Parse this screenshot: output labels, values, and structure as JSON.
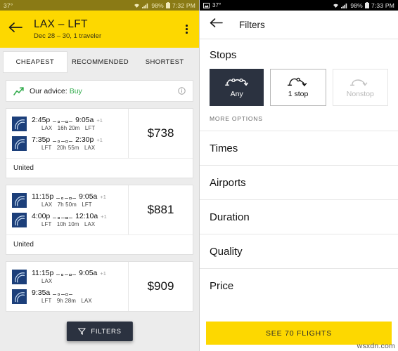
{
  "left": {
    "status": {
      "temp": "37°",
      "battery": "98%",
      "time": "7:32 PM",
      "wifi_icon": "wifi-icon",
      "signal_icon": "signal-icon",
      "battery_icon": "battery-icon"
    },
    "appbar": {
      "back_icon": "back-arrow-icon",
      "title": "LAX – LFT",
      "subtitle": "Dec 28 – 30, 1 traveler",
      "overflow_icon": "overflow-menu-icon"
    },
    "tabs": [
      {
        "label": "CHEAPEST",
        "selected": true
      },
      {
        "label": "RECOMMENDED",
        "selected": false
      },
      {
        "label": "SHORTEST",
        "selected": false
      }
    ],
    "advice": {
      "trend_icon": "trend-up-icon",
      "label": "Our advice:",
      "value": "Buy",
      "info_icon": "info-icon",
      "value_color": "#2faa4a"
    },
    "flights": [
      {
        "price": "$738",
        "airline": "United",
        "legs": [
          {
            "depart_time": "2:45p",
            "arrive_time": "9:05a",
            "plus_days": "+1",
            "origin": "LAX",
            "duration": "16h 20m",
            "destination": "LFT",
            "airline_logo": "united-logo-icon",
            "stops": 2
          },
          {
            "depart_time": "7:35p",
            "arrive_time": "2:30p",
            "plus_days": "+1",
            "origin": "LFT",
            "duration": "20h 55m",
            "destination": "LAX",
            "airline_logo": "united-logo-icon",
            "stops": 2
          }
        ]
      },
      {
        "price": "$881",
        "airline": "United",
        "legs": [
          {
            "depart_time": "11:15p",
            "arrive_time": "9:05a",
            "plus_days": "+1",
            "origin": "LAX",
            "duration": "7h 50m",
            "destination": "LFT",
            "airline_logo": "united-logo-icon",
            "stops": 2
          },
          {
            "depart_time": "4:00p",
            "arrive_time": "12:10a",
            "plus_days": "+1",
            "origin": "LFT",
            "duration": "10h 10m",
            "destination": "LAX",
            "airline_logo": "united-logo-icon",
            "stops": 2
          }
        ]
      },
      {
        "price": "$909",
        "airline": "",
        "legs": [
          {
            "depart_time": "11:15p",
            "arrive_time": "9:05a",
            "plus_days": "+1",
            "origin": "LAX",
            "duration": "",
            "destination": "",
            "airline_logo": "united-logo-icon",
            "stops": 2
          },
          {
            "depart_time": "9:35a",
            "arrive_time": "",
            "plus_days": "",
            "origin": "LFT",
            "duration": "9h 28m",
            "destination": "LAX",
            "airline_logo": "united-logo-icon",
            "stops": 2
          }
        ]
      }
    ],
    "fab": {
      "icon": "funnel-icon",
      "label": "FILTERS"
    }
  },
  "right": {
    "status": {
      "screenshot_icon": "screenshot-icon",
      "temp": "37°",
      "battery": "98%",
      "time": "7:33 PM",
      "wifi_icon": "wifi-icon",
      "signal_icon": "signal-icon",
      "battery_icon": "battery-icon"
    },
    "appbar": {
      "back_icon": "back-arrow-icon",
      "title": "Filters"
    },
    "stops_section": {
      "title": "Stops",
      "options": [
        {
          "label": "Any",
          "state": "selected",
          "icon": "two-stops-icon"
        },
        {
          "label": "1 stop",
          "state": "normal",
          "icon": "one-stop-icon"
        },
        {
          "label": "Nonstop",
          "state": "disabled",
          "icon": "nonstop-icon"
        }
      ],
      "more_options": "MORE OPTIONS"
    },
    "sections": [
      {
        "label": "Times"
      },
      {
        "label": "Airports"
      },
      {
        "label": "Duration"
      },
      {
        "label": "Quality"
      },
      {
        "label": "Price"
      }
    ],
    "cta": {
      "label": "SEE 70 FLIGHTS"
    },
    "watermark": "wsxdn.com"
  }
}
